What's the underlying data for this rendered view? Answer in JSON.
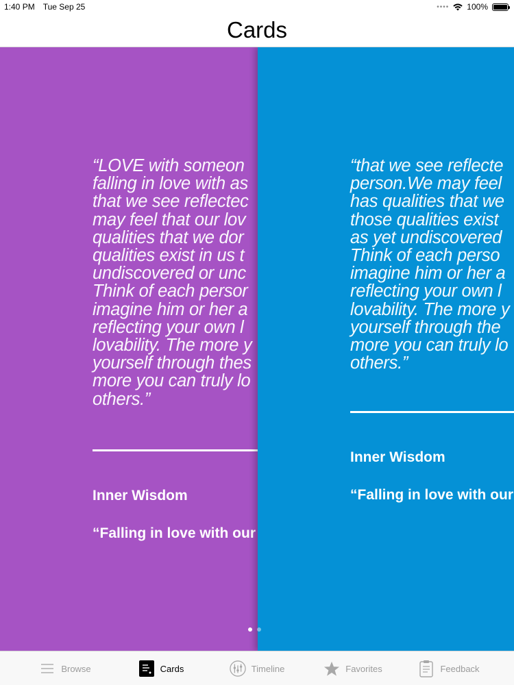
{
  "status_bar": {
    "time": "1:40 PM",
    "date": "Tue Sep 25",
    "battery": "100%",
    "battery_level": 1.0
  },
  "nav": {
    "title": "Cards"
  },
  "cards": [
    {
      "color": "#a653c4",
      "quote": "“LOVE with someon\nfalling in love with as\nthat we see reflectec\nmay feel that our lov\nqualities that we dor\nqualities exist in us t\nundiscovered or unc\nThink of each persor\nimagine him or her a\nreflecting your own l\nlovability. The more y\nyourself through thes\nmore you can truly lo\nothers.”",
      "title": "Inner Wisdom",
      "subtitle": "“Falling in love with our"
    },
    {
      "color": "#0591d6",
      "quote": "“that we see reflecte\nperson.We may feel\nhas qualities that we\nthose qualities exist\nas yet undiscovered\nThink of each perso\nimagine him or her a\nreflecting your own l\nlovability. The more y\nyourself through the\nmore you can truly lo\nothers.”",
      "title": "Inner Wisdom",
      "subtitle": "“Falling in love with our"
    }
  ],
  "page_indicator": {
    "count": 2,
    "current": 1
  },
  "tabs": [
    {
      "label": "Browse",
      "icon": "list-icon",
      "active": false
    },
    {
      "label": "Cards",
      "icon": "cards-icon",
      "active": true
    },
    {
      "label": "Timeline",
      "icon": "timeline-icon",
      "active": false
    },
    {
      "label": "Favorites",
      "icon": "star-icon",
      "active": false
    },
    {
      "label": "Feedback",
      "icon": "clipboard-icon",
      "active": false
    }
  ],
  "colors": {
    "accent_inactive": "#9b9b9b",
    "accent_active": "#000000"
  }
}
